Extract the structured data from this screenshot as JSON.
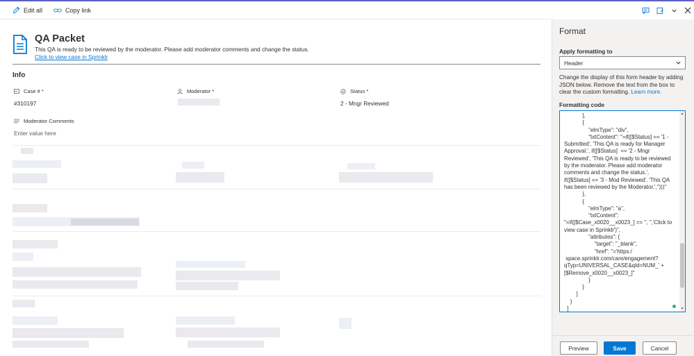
{
  "toolbar": {
    "edit_all": "Edit all",
    "copy_link": "Copy link"
  },
  "form": {
    "title": "QA Packet",
    "subtitle": "This QA is ready to be reviewed by the moderator. Please add moderator comments and change the status.",
    "link_text": "Click to view case in Sprinklr",
    "section": "Info",
    "fields": {
      "case_label": "Case # *",
      "case_value": "#310197",
      "moderator_label": "Moderator *",
      "status_label": "Status *",
      "status_value": "2 - Mngr Reviewed",
      "comments_label": "Moderator Comments",
      "comments_placeholder": "Enter value here"
    }
  },
  "panel": {
    "title": "Format",
    "apply_label": "Apply formatting to",
    "apply_value": "Header",
    "desc": "Change the display of this form header by adding JSON below. Remove the text from the box to clear the custom formatting.",
    "learn_more": "Learn more.",
    "code_label": "Formatting code",
    "code": "            ],\n            {\n                \"elmType\": \"div\",\n                \"txtContent\": \"=if([$Status] == '1 - Submitted', 'This QA is ready for Manager Approval.', if([$Status]  == '2 - Mngr Reviewed', 'This QA is ready to be reviewed by the moderator. Please add moderator comments and change the status.', if([$Status] == '3 - Mod Reviewed', 'This QA has been reviewed by the Moderator.','')))\"\n            },\n            {\n                \"elmType\": \"a\",\n                \"txtContent\": \"=if([$Case_x0020__x0023_] == '', '','Click to view case in Sprinklr')\",\n                \"attributes\": {\n                    \"target\": \"_blank\",\n                    \"href\": \"='https:/\n space.sprinklr.com/care/engagement?qTyp=UNIVERSAL_CASE&qId=NUM_' + [$Remove_x0020__x0023_]\"\n                }\n            }\n        ]\n    }\n  ]\n}",
    "buttons": {
      "preview": "Preview",
      "save": "Save",
      "cancel": "Cancel"
    }
  },
  "colors": {
    "accent": "#0078d4",
    "topline": "#5b5fc7"
  }
}
